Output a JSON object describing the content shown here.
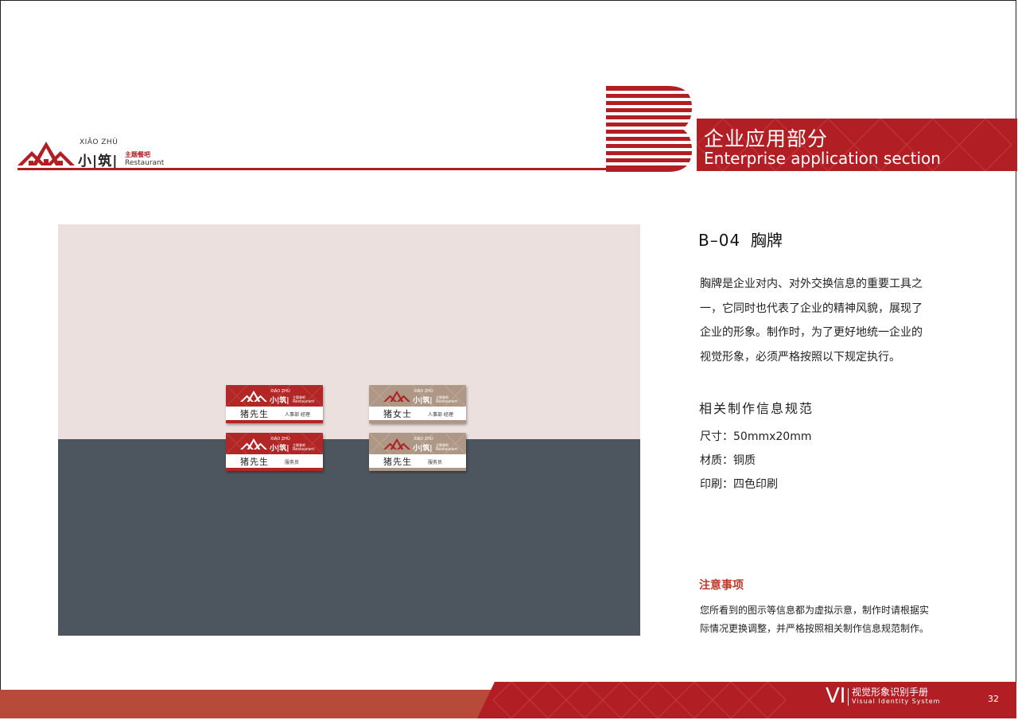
{
  "colors": {
    "brand_red": "#b11f24",
    "badge_tan": "#ae9785",
    "wall": "#ece0df",
    "floor": "#4d555e",
    "note_red": "#c0392b"
  },
  "logo": {
    "pinyin": "XIĂO ZHÙ",
    "main": "小|筑|",
    "sub": "主题餐吧",
    "en": "Restaurant"
  },
  "header": {
    "section_zh": "企业应用部分",
    "section_en": "Enterprise application section"
  },
  "badges": [
    {
      "name": "猪先生",
      "role": "人事部 经理",
      "style": "red"
    },
    {
      "name": "猪女士",
      "role": "人事部 经理",
      "style": "tan"
    },
    {
      "name": "猪先生",
      "role": "服务员",
      "style": "red"
    },
    {
      "name": "猪先生",
      "role": "服务员",
      "style": "tan"
    }
  ],
  "badge_logo": {
    "pinyin": "XIĂO ZHÙ",
    "main": "小|筑|",
    "sub": "主题餐吧",
    "en": "Restaurant"
  },
  "section": {
    "code": "B–04",
    "title": "胸牌",
    "paragraph_lines": [
      "胸牌是企业对内、对外交换信息的重要工具之",
      "一，它同时也代表了企业的精神风貌，展现了",
      "企业的形象。制作时，为了更好地统一企业的",
      "视觉形象，必须严格按照以下规定执行。"
    ],
    "spec_title": "相关制作信息规范",
    "specs": [
      "尺寸：50mmx20mm",
      "材质：铜质",
      "印刷：四色印刷"
    ],
    "note_title": "注意事项",
    "note_lines": [
      "您所看到的图示等信息都为虚拟示意，制作时请根据实",
      "际情况更换调整，并严格按照相关制作信息规范制作。"
    ]
  },
  "footer": {
    "vi": "VI",
    "zh": "视觉形象识别手册",
    "en": "Visual Identity System",
    "page": "32"
  }
}
